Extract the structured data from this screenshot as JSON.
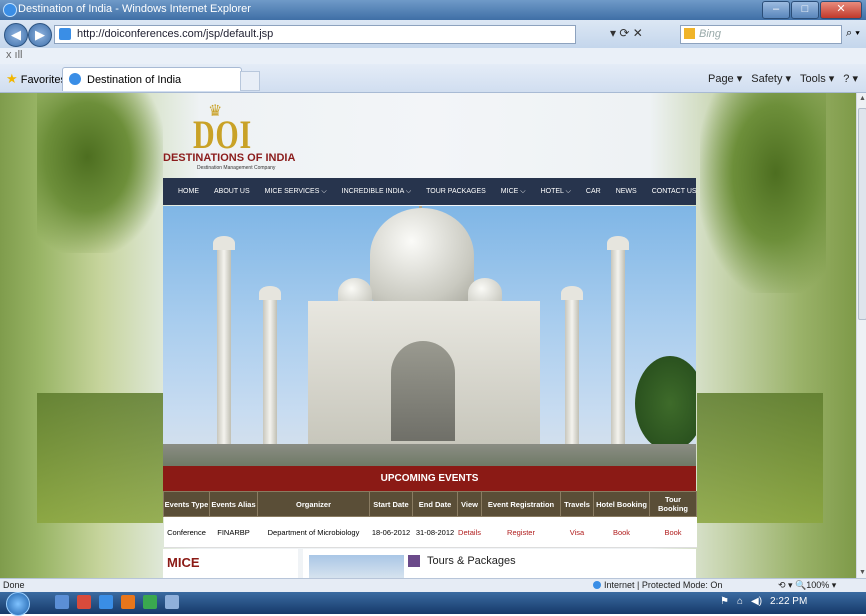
{
  "window": {
    "title": "Destination of India - Windows Internet Explorer",
    "min": "–",
    "max": "□",
    "close": "✕"
  },
  "addressbar": {
    "back": "◀",
    "forward": "▶",
    "url": "http://doiconferences.com/jsp/default.jsp",
    "tools": "▾ ⟳ ✕",
    "search_placeholder": "Bing",
    "search_icon": "⌕ ▾"
  },
  "xbar": {
    "text": "x  ıll"
  },
  "favorites": {
    "label": "Favorites",
    "tab_title": "Destination of India"
  },
  "commandbar": [
    "Page ▾",
    "Safety ▾",
    "Tools ▾",
    "? ▾"
  ],
  "site": {
    "logo_text": "DOI",
    "crown": "♛",
    "name": "DESTINATIONS OF INDIA",
    "tagline": "Destination Management Company",
    "nav": [
      "HOME",
      "ABOUT US",
      "MICE SERVICES ⌵",
      "INCREDIBLE INDIA ⌵",
      "TOUR PACKAGES",
      "MICE ⌵",
      "HOTEL ⌵",
      "CAR",
      "NEWS",
      "CONTACT US"
    ],
    "events": {
      "heading": "UPCOMING EVENTS",
      "columns": [
        "Events Type",
        "Events Alias",
        "Organizer",
        "Start Date",
        "End Date",
        "View",
        "Event Registration",
        "Travels",
        "Hotel Booking",
        "Tour Booking"
      ],
      "rows": [
        [
          "Conference",
          "FINARBP",
          "Department of Microbiology",
          "18-06-2012",
          "31-08-2012",
          "Details",
          "Register",
          "Visa",
          "Book",
          "Book"
        ]
      ]
    },
    "mice_heading": "MICE",
    "tours_heading": "Tours & Packages"
  },
  "status": {
    "left": "Done",
    "zone": "Internet | Protected Mode: On",
    "zoom": "⟲ ▾  🔍100%  ▾"
  },
  "taskbar": {
    "clock": "2:22 PM"
  },
  "colors": {
    "nav_bg": "#27344d",
    "events_head": "#8b1a15",
    "table_head": "#5a4e37",
    "logo_gold": "#c9a227"
  }
}
